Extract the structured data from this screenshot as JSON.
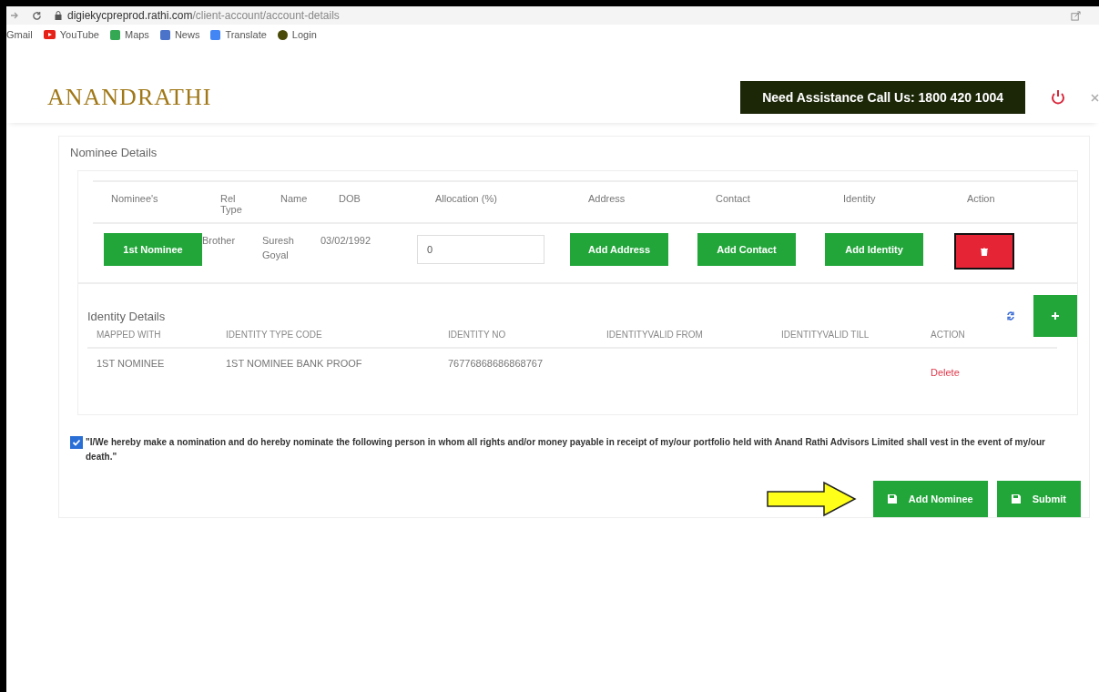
{
  "browser": {
    "url_host": "digiekycpreprod.rathi.com",
    "url_path": "/client-account/account-details",
    "bookmarks": [
      {
        "label": "Gmail",
        "kind": "plain"
      },
      {
        "label": "YouTube",
        "kind": "play"
      },
      {
        "label": "Maps",
        "kind": "tile"
      },
      {
        "label": "News",
        "kind": "tile"
      },
      {
        "label": "Translate",
        "kind": "tile"
      },
      {
        "label": "Login",
        "kind": "circle"
      }
    ]
  },
  "header": {
    "logo": "ANANDRATHI",
    "assistance": "Need Assistance Call Us: 1800 420 1004"
  },
  "nominee_section": {
    "title": "Nominee Details",
    "columns": [
      "Nominee's",
      "Rel Type",
      "Name",
      "DOB",
      "Allocation (%)",
      "Address",
      "Contact",
      "Identity",
      "Action"
    ],
    "rows": [
      {
        "nominee": "1st Nominee",
        "rel_type": "Brother",
        "name": "Suresh Goyal",
        "dob": "03/02/1992",
        "allocation": "0",
        "address": "Add Address",
        "contact": "Add Contact",
        "identity": "Add Identity"
      }
    ]
  },
  "identity_section": {
    "title": "Identity Details",
    "columns": [
      "MAPPED WITH",
      "IDENTITY TYPE CODE",
      "IDENTITY NO",
      "IDENTITYVALID FROM",
      "IDENTITYVALID TILL",
      "ACTION"
    ],
    "rows": [
      {
        "mapped_with": "1ST NOMINEE",
        "type_code": "1ST NOMINEE BANK PROOF",
        "identity_no": "76776868686868767",
        "action": "Delete"
      }
    ]
  },
  "declaration": {
    "checked": true,
    "text": "\"I/We hereby make a nomination and do hereby nominate the following person in whom all rights and/or money payable in receipt of my/our portfolio held with Anand Rathi Advisors Limited shall vest in the event of my/our death.\""
  },
  "buttons": [
    {
      "label": "Add Nominee"
    },
    {
      "label": "Submit"
    }
  ]
}
